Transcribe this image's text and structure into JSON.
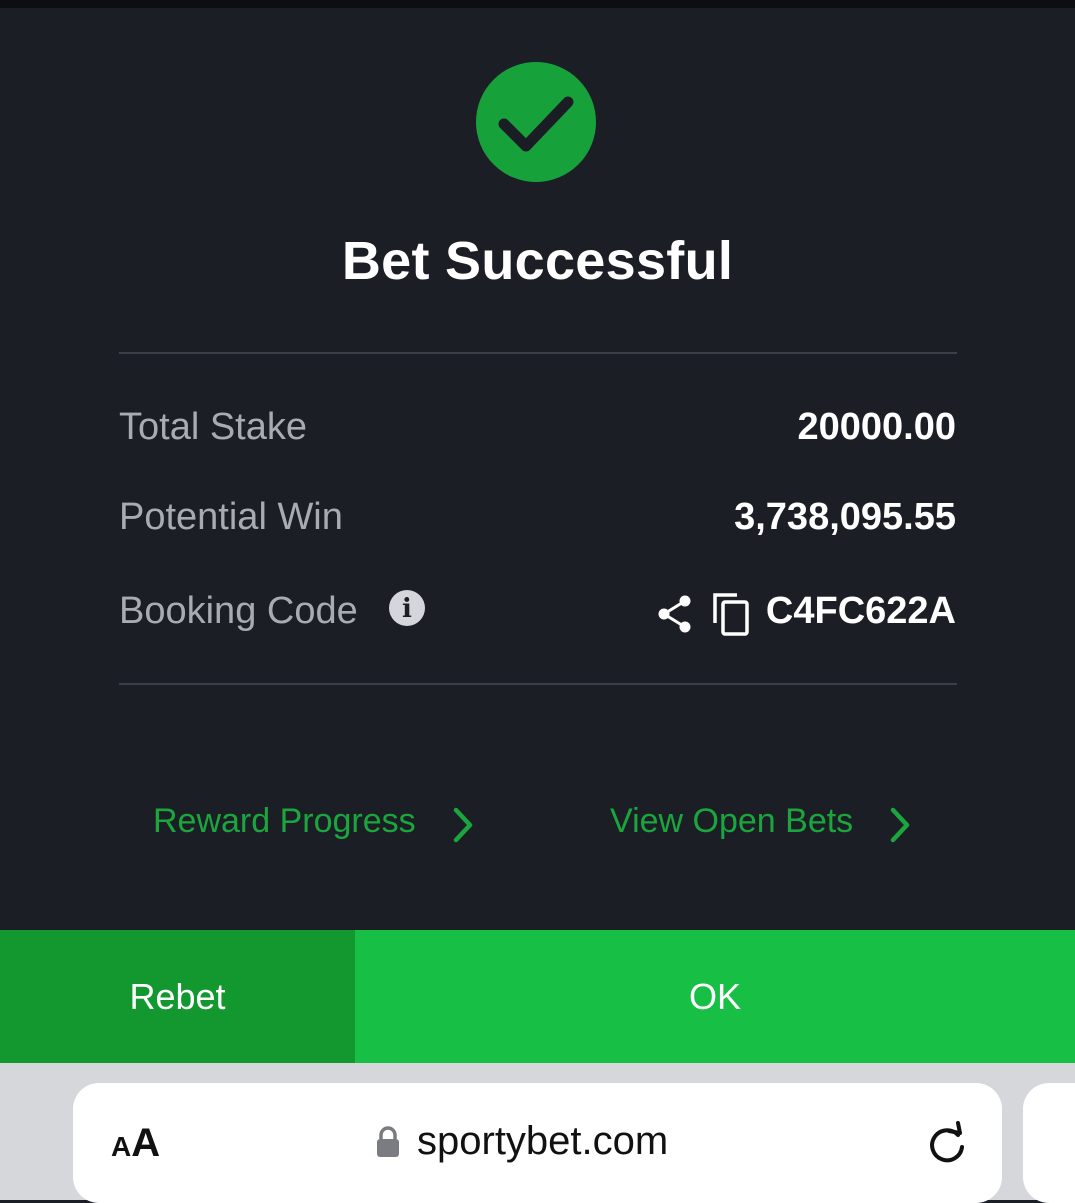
{
  "modal": {
    "title": "Bet Successful",
    "rows": [
      {
        "label": "Total Stake",
        "value": "20000.00"
      },
      {
        "label": "Potential Win",
        "value": "3,738,095.55"
      },
      {
        "label": "Booking Code",
        "value": "C4FC622A"
      }
    ],
    "info_icon_glyph": "i",
    "links": {
      "reward_progress": "Reward Progress",
      "view_open_bets": "View Open Bets"
    },
    "buttons": {
      "rebet": "Rebet",
      "ok": "OK"
    },
    "colors": {
      "background": "#1c1e26",
      "success_green": "#17a13b",
      "link_green": "#1aa63d",
      "rebet_green": "#12982f",
      "ok_green": "#17bf45"
    },
    "icons": [
      "checkmark-icon",
      "info-icon",
      "share-icon",
      "copy-icon",
      "chevron-right-icon"
    ]
  },
  "browser": {
    "text_size_small": "A",
    "text_size_big": "A",
    "url": "sportybet.com",
    "icons": [
      "lock-icon",
      "reload-icon"
    ]
  }
}
